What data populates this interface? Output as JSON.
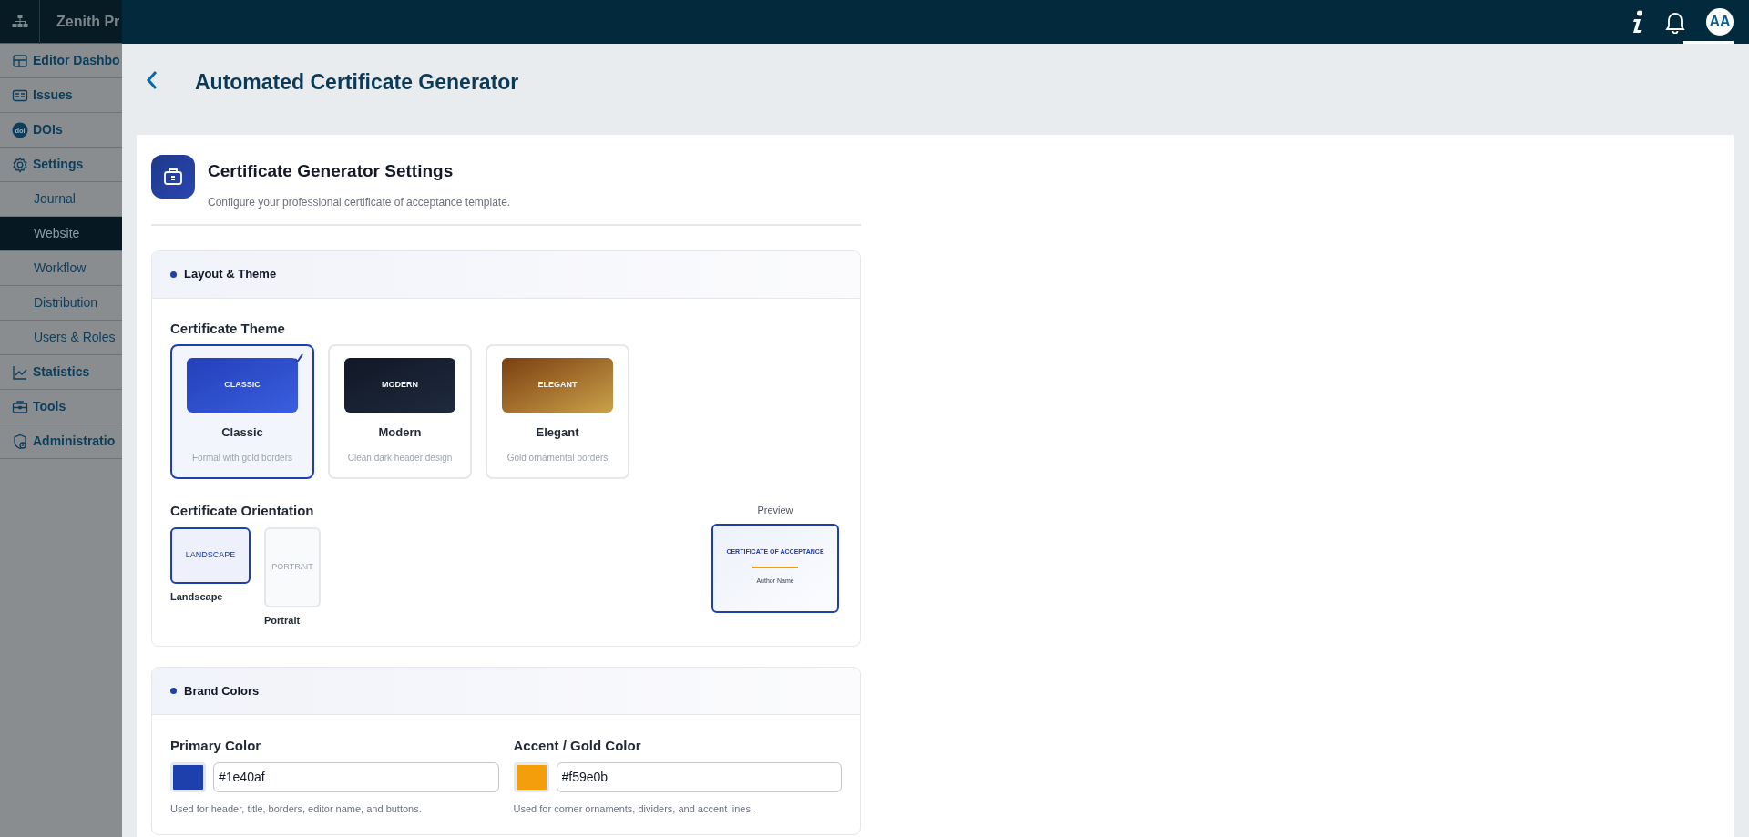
{
  "sidebar": {
    "brand": "Zenith Pr",
    "items": [
      {
        "label": "Editor Dashbo",
        "kind": "dashboard",
        "selected": false
      },
      {
        "label": "Issues",
        "kind": "issues",
        "selected": false
      },
      {
        "label": "DOIs",
        "kind": "doi",
        "badge": "doi",
        "selected": false
      },
      {
        "label": "Settings",
        "kind": "settings",
        "selected": false,
        "children": [
          {
            "label": "Journal",
            "selected": false
          },
          {
            "label": "Website",
            "selected": true
          },
          {
            "label": "Workflow",
            "selected": false
          },
          {
            "label": "Distribution",
            "selected": false
          },
          {
            "label": "Users & Roles",
            "selected": false
          }
        ]
      },
      {
        "label": "Statistics",
        "kind": "statistics",
        "selected": false
      },
      {
        "label": "Tools",
        "kind": "tools",
        "selected": false
      },
      {
        "label": "Administratio",
        "kind": "admin",
        "selected": false
      }
    ]
  },
  "top_bar": {
    "avatar": "AA"
  },
  "page": {
    "title": "Automated Certificate Generator"
  },
  "settings": {
    "title": "Certificate Generator Settings",
    "subtitle": "Configure your professional certificate of acceptance template."
  },
  "layout_theme": {
    "heading": "Layout & Theme",
    "theme_label": "Certificate Theme",
    "themes": [
      {
        "kind": "classic",
        "thumb": "CLASSIC",
        "name": "Classic",
        "description": "Formal with gold borders",
        "selected": true
      },
      {
        "kind": "modern",
        "thumb": "MODERN",
        "name": "Modern",
        "description": "Clean dark header design",
        "selected": false
      },
      {
        "kind": "elegant",
        "thumb": "ELEGANT",
        "name": "Elegant",
        "description": "Gold ornamental borders",
        "selected": false
      }
    ],
    "orientation_label": "Certificate Orientation",
    "orientations": [
      {
        "kind": "landscape",
        "thumb": "LANDSCAPE",
        "name": "Landscape",
        "selected": true
      },
      {
        "kind": "portrait",
        "thumb": "PORTRAIT",
        "name": "Portrait",
        "selected": false
      }
    ],
    "preview": {
      "label": "Preview",
      "heading": "CERTIFICATE OF ACCEPTANCE",
      "author": "Author Name"
    }
  },
  "brand_colors": {
    "heading": "Brand Colors",
    "fields": [
      {
        "label": "Primary Color",
        "value": "#1e40af",
        "help": "Used for header, title, borders, editor name, and buttons."
      },
      {
        "label": "Accent / Gold Color",
        "value": "#f59e0b",
        "help": "Used for corner ornaments, dividers, and accent lines."
      }
    ]
  }
}
